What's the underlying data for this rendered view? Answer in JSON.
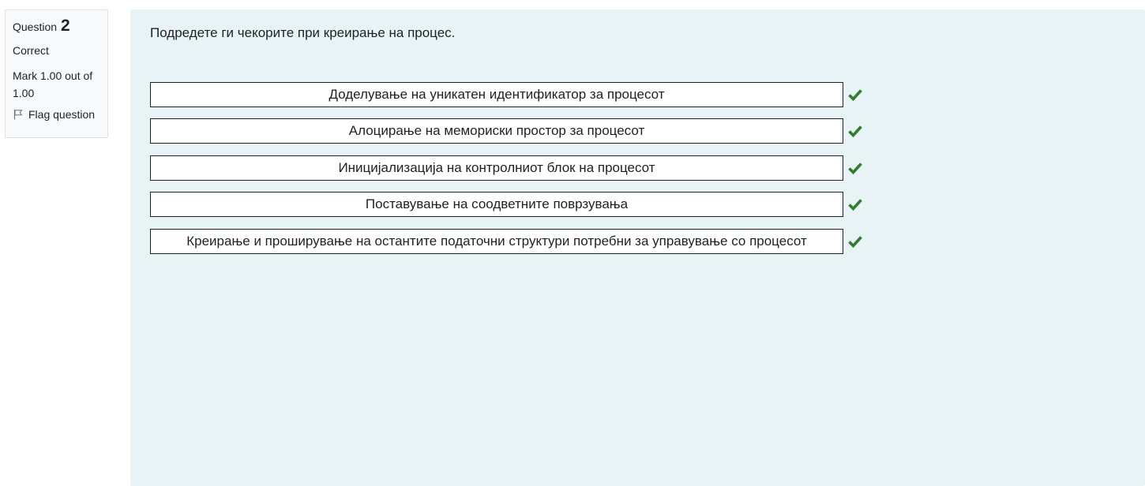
{
  "info": {
    "question_label": "Question",
    "question_number": "2",
    "state": "Correct",
    "grade": "Mark 1.00 out of 1.00",
    "flag_label": "Flag question"
  },
  "question": {
    "text": "Подредете ги чекорите при креирање на процес.",
    "items": [
      {
        "text": "Доделување на уникатен идентификатор за процесот",
        "correct_icon": "check-icon"
      },
      {
        "text": "Алоцирање на мемориски простор за процесот",
        "correct_icon": "check-icon"
      },
      {
        "text": "Иницијализација на контролниот блок на процесот",
        "correct_icon": "check-icon"
      },
      {
        "text": "Поставување на соодветните поврзувања",
        "correct_icon": "check-icon"
      },
      {
        "text": "Креирање и проширување на остантите податочни структури потребни за управување со процесот",
        "correct_icon": "check-icon"
      }
    ]
  },
  "colors": {
    "panel_bg": "#e7f3f5",
    "info_bg": "#f8f9fa",
    "check_green": "#357a32"
  }
}
